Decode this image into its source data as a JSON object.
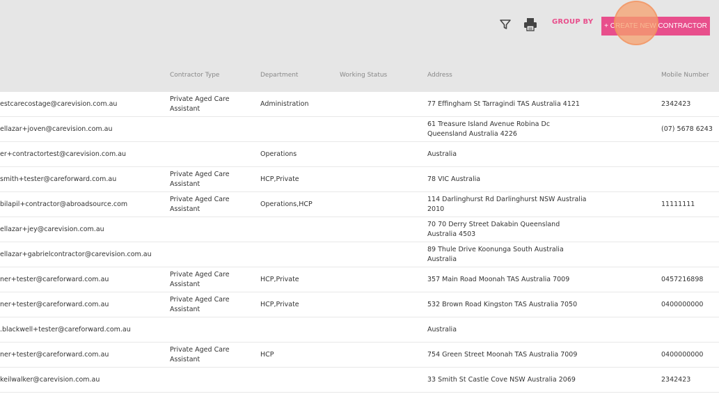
{
  "toolbar": {
    "filter_icon": "filter-icon",
    "print_icon": "printer-icon",
    "group_by_label": "GROUP BY",
    "create_button_label": "+ CREATE NEW CONTRACTOR",
    "accent_color": "#e84f8c"
  },
  "table": {
    "headers": {
      "contractor_type": "Contractor Type",
      "department": "Department",
      "working_status": "Working Status",
      "address": "Address",
      "mobile_number": "Mobile Number"
    },
    "rows": [
      {
        "email": "estcarecostage@carevision.com.au",
        "contractor_type": "Private Aged Care Assistant",
        "department": "Administration",
        "working_status": "",
        "address": "77 Effingham St Tarragindi TAS Australia 4121",
        "mobile": "2342423"
      },
      {
        "email": "ellazar+joven@carevision.com.au",
        "contractor_type": "",
        "department": "",
        "working_status": "",
        "address": "61 Treasure Island Avenue Robina Dc Queensland Australia 4226",
        "mobile": "(07) 5678 6243"
      },
      {
        "email": "er+contractortest@carevision.com.au",
        "contractor_type": "",
        "department": "Operations",
        "working_status": "",
        "address": "Australia",
        "mobile": ""
      },
      {
        "email": "smith+tester@careforward.com.au",
        "contractor_type": "Private Aged Care Assistant",
        "department": "HCP,Private",
        "working_status": "",
        "address": "78 VIC Australia",
        "mobile": ""
      },
      {
        "email": "bilapil+contractor@abroadsource.com",
        "contractor_type": "Private Aged Care Assistant",
        "department": "Operations,HCP",
        "working_status": "",
        "address": "114 Darlinghurst Rd Darlinghurst NSW Australia 2010",
        "mobile": "11111111"
      },
      {
        "email": "ellazar+jey@carevision.com.au",
        "contractor_type": "",
        "department": "",
        "working_status": "",
        "address": "70 70 Derry Street Dakabin Queensland Australia 4503",
        "mobile": ""
      },
      {
        "email": "ellazar+gabrielcontractor@carevision.com.au",
        "contractor_type": "",
        "department": "",
        "working_status": "",
        "address": "89 Thule Drive Koonunga South Australia Australia",
        "mobile": ""
      },
      {
        "email": "ner+tester@careforward.com.au",
        "contractor_type": "Private Aged Care Assistant",
        "department": "HCP,Private",
        "working_status": "",
        "address": "357 Main Road Moonah TAS Australia 7009",
        "mobile": "0457216898"
      },
      {
        "email": "ner+tester@careforward.com.au",
        "contractor_type": "Private Aged Care Assistant",
        "department": "HCP,Private",
        "working_status": "",
        "address": "532 Brown Road Kingston TAS Australia 7050",
        "mobile": "0400000000"
      },
      {
        "email": ".blackwell+tester@careforward.com.au",
        "contractor_type": "",
        "department": "",
        "working_status": "",
        "address": "Australia",
        "mobile": ""
      },
      {
        "email": "ner+tester@careforward.com.au",
        "contractor_type": "Private Aged Care Assistant",
        "department": "HCP",
        "working_status": "",
        "address": "754 Green Street Moonah TAS Australia 7009",
        "mobile": "0400000000"
      },
      {
        "email": "keilwalker@carevision.com.au",
        "contractor_type": "",
        "department": "",
        "working_status": "",
        "address": "33 Smith St Castle Cove NSW Australia 2069",
        "mobile": "2342423"
      }
    ]
  }
}
